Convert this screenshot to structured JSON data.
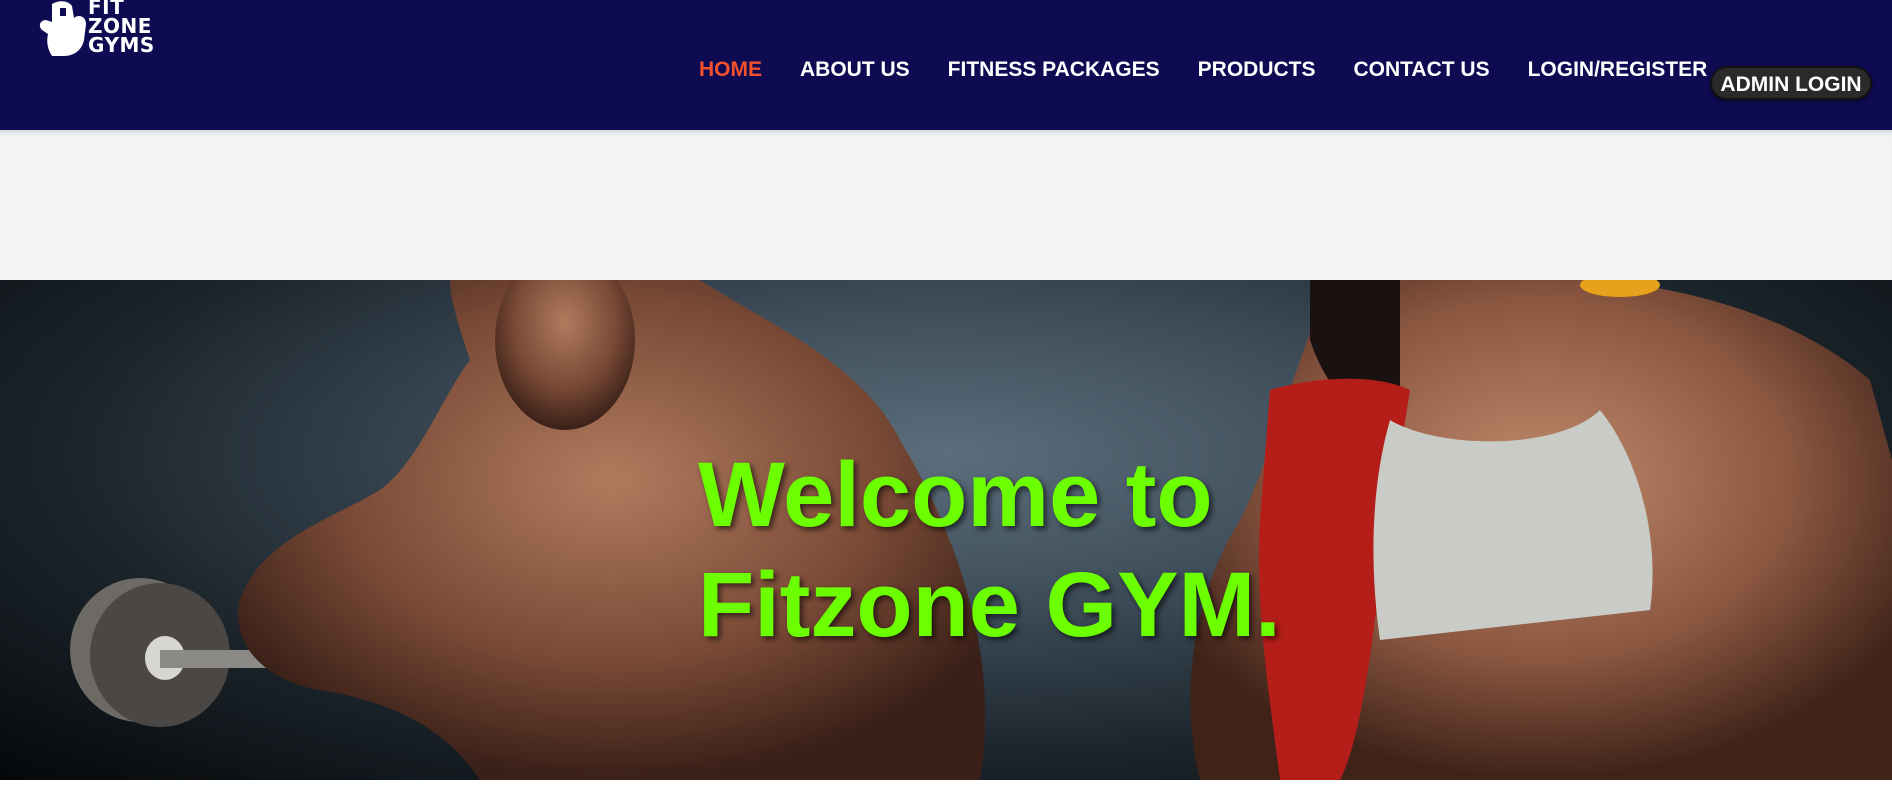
{
  "header": {
    "logo": {
      "lines": [
        "FIT",
        "ZONE",
        "GYMS"
      ],
      "icon": "flexed-arm-icon"
    },
    "nav": {
      "items": [
        {
          "label": "HOME",
          "active": true
        },
        {
          "label": "ABOUT US",
          "active": false
        },
        {
          "label": "FITNESS PACKAGES",
          "active": false
        },
        {
          "label": "PRODUCTS",
          "active": false
        },
        {
          "label": "CONTACT US",
          "active": false
        },
        {
          "label": "LOGIN/REGISTER",
          "active": false
        }
      ]
    },
    "admin_button_label": "ADMIN LOGIN"
  },
  "hero": {
    "title_line1": "Welcome to",
    "title_line2": "Fitzone GYM.",
    "background": "gym-athletes-photo"
  },
  "colors": {
    "navbar": "#0e0b52",
    "active_nav": "#f4512c",
    "hero_title": "#6cff00",
    "gap_band": "#f3f4f6"
  }
}
